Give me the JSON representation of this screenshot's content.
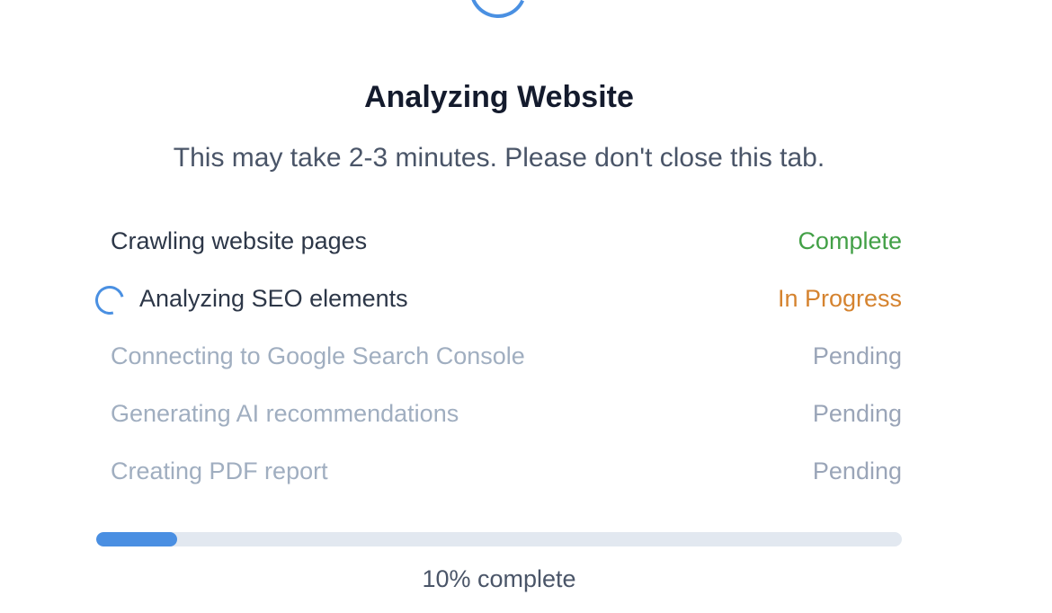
{
  "header": {
    "loading_icon": "spinner-icon",
    "title": "Analyzing Website",
    "subtitle": "This may take 2-3 minutes. Please don't close this tab."
  },
  "steps": [
    {
      "label": "Crawling website pages",
      "status": "Complete",
      "state": "done",
      "status_color": "#43a047"
    },
    {
      "label": "Analyzing SEO elements",
      "status": "In Progress",
      "state": "active",
      "status_color": "#d5832f",
      "icon": "spinner-icon"
    },
    {
      "label": "Connecting to Google Search Console",
      "status": "Pending",
      "state": "pending",
      "status_color": "#9aa5b8"
    },
    {
      "label": "Generating AI recommendations",
      "status": "Pending",
      "state": "pending",
      "status_color": "#9aa5b8"
    },
    {
      "label": "Creating PDF report",
      "status": "Pending",
      "state": "pending",
      "status_color": "#9aa5b8"
    }
  ],
  "progress": {
    "value": 0.1,
    "label": "10% complete",
    "fill_color": "#4a8fe2",
    "track_color": "#e2e8f0"
  }
}
